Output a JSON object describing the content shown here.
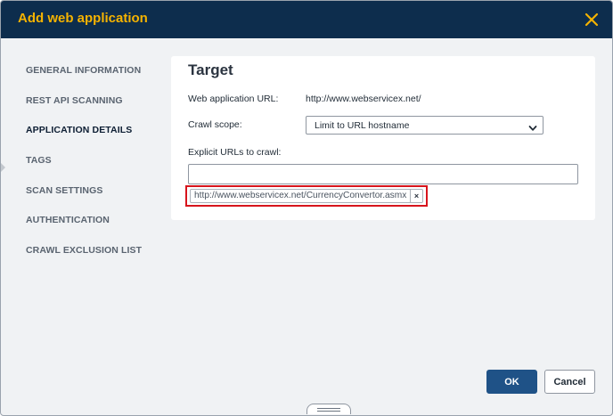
{
  "dialog": {
    "title": "Add web application",
    "close_icon": "close-icon",
    "accent_color": "#f5b300",
    "header_color": "#0d2d4d"
  },
  "sidebar": {
    "items": [
      {
        "label": "GENERAL INFORMATION",
        "active": false
      },
      {
        "label": "REST API SCANNING",
        "active": false
      },
      {
        "label": "APPLICATION DETAILS",
        "active": true
      },
      {
        "label": "TAGS",
        "active": false
      },
      {
        "label": "SCAN SETTINGS",
        "active": false
      },
      {
        "label": "AUTHENTICATION",
        "active": false
      },
      {
        "label": "CRAWL EXCLUSION LIST",
        "active": false
      }
    ]
  },
  "target": {
    "heading": "Target",
    "web_app_url_label": "Web application URL:",
    "web_app_url_value": "http://www.webservicex.net/",
    "crawl_scope_label": "Crawl scope:",
    "crawl_scope_value": "Limit to URL hostname",
    "explicit_urls_label": "Explicit URLs to crawl:",
    "explicit_urls_input_value": "",
    "explicit_urls": [
      {
        "url": "http://www.webservicex.net/CurrencyConvertor.asmx",
        "remove_label": "×"
      }
    ],
    "highlight_color": "#d7141c"
  },
  "footer": {
    "ok_label": "OK",
    "cancel_label": "Cancel",
    "primary_color": "#1f5287"
  }
}
